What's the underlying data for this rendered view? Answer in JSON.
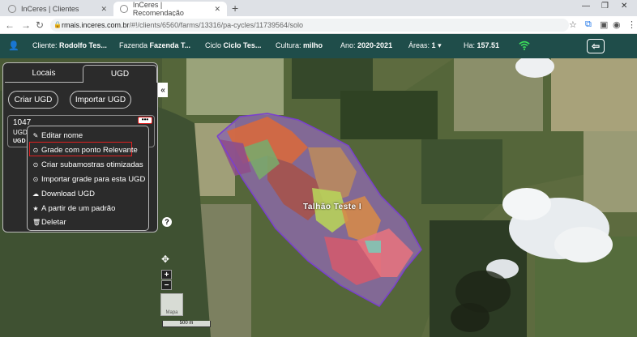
{
  "browser": {
    "tabs": [
      {
        "title": "InCeres | Clientes"
      },
      {
        "title": "InCeres | Recomendação"
      }
    ],
    "url_host": "rmais.inceres.com.br",
    "url_path": "/#!/clients/6560/farms/13316/pa-cycles/11739564/solo"
  },
  "header": {
    "cliente_label": "Cliente:",
    "cliente_value": "Rodolfo Tes...",
    "fazenda_label": "Fazenda",
    "fazenda_value": "Fazenda T...",
    "ciclo_label": "Ciclo",
    "ciclo_value": "Ciclo Tes...",
    "cultura_label": "Cultura:",
    "cultura_value": "milho",
    "ano_label": "Ano:",
    "ano_value": "2020-2021",
    "areas_label": "Áreas:",
    "areas_value": "1",
    "ha_label": "Ha:",
    "ha_value": "157.51"
  },
  "panel": {
    "tab_locais": "Locais",
    "tab_ugd": "UGD",
    "btn_criar": "Criar UGD",
    "btn_importar": "Importar UGD",
    "card_title": "1047",
    "card_sub": "UGD",
    "card_sub2": "UGD",
    "more": "•••"
  },
  "menu": {
    "items": [
      {
        "label": "Editar nome",
        "icon": "pencil-icon"
      },
      {
        "label": "Grade com ponto Relevante",
        "icon": "circle-dot-icon"
      },
      {
        "label": "Criar subamostras otimizadas",
        "icon": "circle-dot-icon"
      },
      {
        "label": "Importar grade para esta UGD",
        "icon": "circle-dot-icon"
      },
      {
        "label": "Download UGD",
        "icon": "cloud-download-icon"
      },
      {
        "label": "A partir de um padrão",
        "icon": "star-icon"
      },
      {
        "label": "Deletar",
        "icon": "trash-icon"
      }
    ]
  },
  "map": {
    "field_label": "Talhão Teste I",
    "scale": "500 m",
    "help": "?",
    "zoom_in": "+",
    "zoom_out": "−",
    "thumb_label": "Mapa"
  },
  "colors": {
    "header_bg": "#1f4d4a",
    "highlight": "#e02020",
    "panel_bg": "#2b2b2b"
  }
}
